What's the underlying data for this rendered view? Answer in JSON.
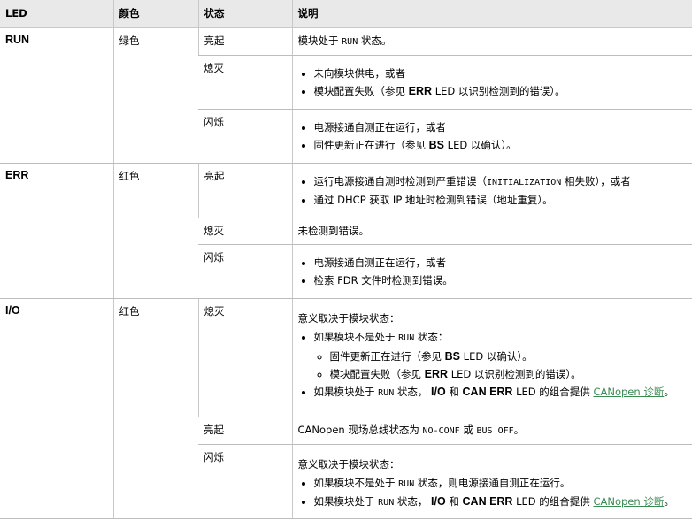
{
  "headers": {
    "led": "LED",
    "color": "颜色",
    "state": "状态",
    "desc": "说明"
  },
  "run": {
    "led": "RUN",
    "color": "绿色",
    "on": {
      "state": "亮起",
      "pre": "模块处于 ",
      "code": "RUN",
      "post": " 状态。"
    },
    "off": {
      "state": "熄灭",
      "item1": "未向模块供电，或者",
      "item2_pre": "模块配置失败（参见 ",
      "item2_bold": "ERR",
      "item2_post": " LED 以识别检测到的错误）。"
    },
    "blink": {
      "state": "闪烁",
      "item1": "电源接通自测正在运行，或者",
      "item2_pre": "固件更新正在进行（参见 ",
      "item2_bold": "BS",
      "item2_post": " LED 以确认）。"
    }
  },
  "err": {
    "led": "ERR",
    "color": "红色",
    "on": {
      "state": "亮起",
      "item1_pre": "运行电源接通自测时检测到严重错误（",
      "item1_code": "INITIALIZATION",
      "item1_post": " 相失败），或者",
      "item2": "通过 DHCP 获取 IP 地址时检测到错误（地址重复）。"
    },
    "off": {
      "state": "熄灭",
      "text": "未检测到错误。"
    },
    "blink": {
      "state": "闪烁",
      "item1": "电源接通自测正在运行，或者",
      "item2": "检索 FDR 文件时检测到错误。"
    }
  },
  "io": {
    "led": "I/O",
    "color": "红色",
    "off": {
      "state": "熄灭",
      "intro": "意义取决于模块状态：",
      "item1_pre": "如果模块不是处于 ",
      "item1_code": "RUN",
      "item1_post": " 状态：",
      "sub1_pre": "固件更新正在进行（参见 ",
      "sub1_bold": "BS",
      "sub1_post": " LED 以确认）。",
      "sub2_pre": "模块配置失败（参见 ",
      "sub2_bold": "ERR",
      "sub2_post": " LED 以识别检测到的错误）。",
      "item2_pre": "如果模块处于 ",
      "item2_code": "RUN",
      "item2_mid1": " 状态， ",
      "item2_b1": "I/O",
      "item2_mid2": " 和 ",
      "item2_b2": "CAN ERR",
      "item2_mid3": " LED 的组合提供 ",
      "item2_link": "CANopen 诊断",
      "item2_post": "。"
    },
    "on": {
      "state": "亮起",
      "pre": "CANopen 现场总线状态为 ",
      "code1": "NO-CONF",
      "mid": " 或 ",
      "code2": "BUS OFF",
      "post": "。"
    },
    "blink": {
      "state": "闪烁",
      "intro": "意义取决于模块状态：",
      "item1_pre": "如果模块不是处于 ",
      "item1_code": "RUN",
      "item1_post": " 状态，则电源接通自测正在运行。",
      "item2_pre": "如果模块处于 ",
      "item2_code": "RUN",
      "item2_mid1": " 状态， ",
      "item2_b1": "I/O",
      "item2_mid2": " 和 ",
      "item2_b2": "CAN ERR",
      "item2_mid3": " LED 的组合提供 ",
      "item2_link": "CANopen 诊断",
      "item2_post": "。"
    }
  }
}
